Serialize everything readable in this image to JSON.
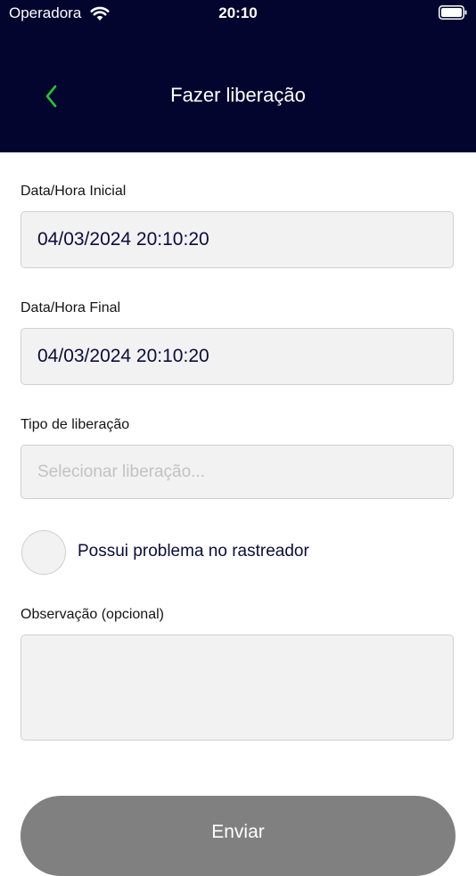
{
  "status_bar": {
    "carrier": "Operadora",
    "time": "20:10",
    "wifi_icon": "wifi-icon",
    "battery_icon": "battery-icon"
  },
  "header": {
    "title": "Fazer liberação",
    "back_icon": "chevron-left-icon",
    "background_color": "#03052f",
    "accent_color": "#22c533"
  },
  "form": {
    "start": {
      "label": "Data/Hora Inicial",
      "value": "04/03/2024 20:10:20"
    },
    "end": {
      "label": "Data/Hora Final",
      "value": "04/03/2024 20:10:20"
    },
    "release_type": {
      "label": "Tipo de liberação",
      "placeholder": "Selecionar liberação..."
    },
    "tracker_problem": {
      "label": "Possui problema no rastreador",
      "checked": false
    },
    "notes": {
      "label": "Observação (opcional)",
      "value": ""
    }
  },
  "submit": {
    "label": "Enviar",
    "background_color": "#808080"
  }
}
